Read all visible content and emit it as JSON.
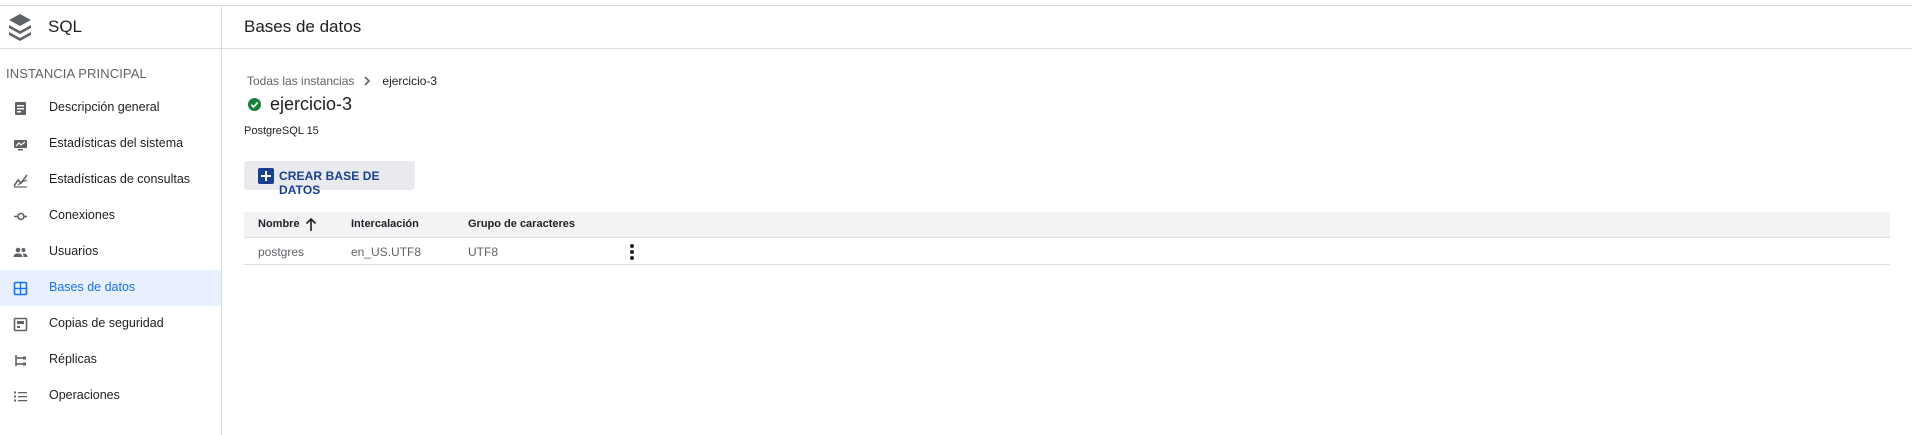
{
  "app": {
    "title": "SQL"
  },
  "sidebar": {
    "section_title": "INSTANCIA PRINCIPAL",
    "items": [
      {
        "label": "Descripción general",
        "icon": "overview-icon",
        "active": false
      },
      {
        "label": "Estadísticas del sistema",
        "icon": "system-insights-icon",
        "active": false
      },
      {
        "label": "Estadísticas de consultas",
        "icon": "query-insights-icon",
        "active": false
      },
      {
        "label": "Conexiones",
        "icon": "connections-icon",
        "active": false
      },
      {
        "label": "Usuarios",
        "icon": "users-icon",
        "active": false
      },
      {
        "label": "Bases de datos",
        "icon": "databases-icon",
        "active": true
      },
      {
        "label": "Copias de seguridad",
        "icon": "backups-icon",
        "active": false
      },
      {
        "label": "Réplicas",
        "icon": "replicas-icon",
        "active": false
      },
      {
        "label": "Operaciones",
        "icon": "operations-icon",
        "active": false
      }
    ]
  },
  "header": {
    "title": "Bases de datos"
  },
  "breadcrumb": {
    "root": "Todas las instancias",
    "current": "ejercicio-3"
  },
  "instance": {
    "name": "ejercicio-3",
    "status": "running",
    "version": "PostgreSQL 15"
  },
  "actions": {
    "create_label": "CREAR BASE DE DATOS"
  },
  "table": {
    "columns": [
      "Nombre",
      "Intercalación",
      "Grupo de caracteres"
    ],
    "sort": {
      "column": "Nombre",
      "direction": "ascending"
    },
    "rows": [
      {
        "name": "postgres",
        "collation": "en_US.UTF8",
        "charset": "UTF8"
      }
    ]
  },
  "colors": {
    "accent": "#1a73e8",
    "active_bg": "#e8f0fe",
    "button_text": "#1a3f8f",
    "status_ok": "#188038"
  }
}
